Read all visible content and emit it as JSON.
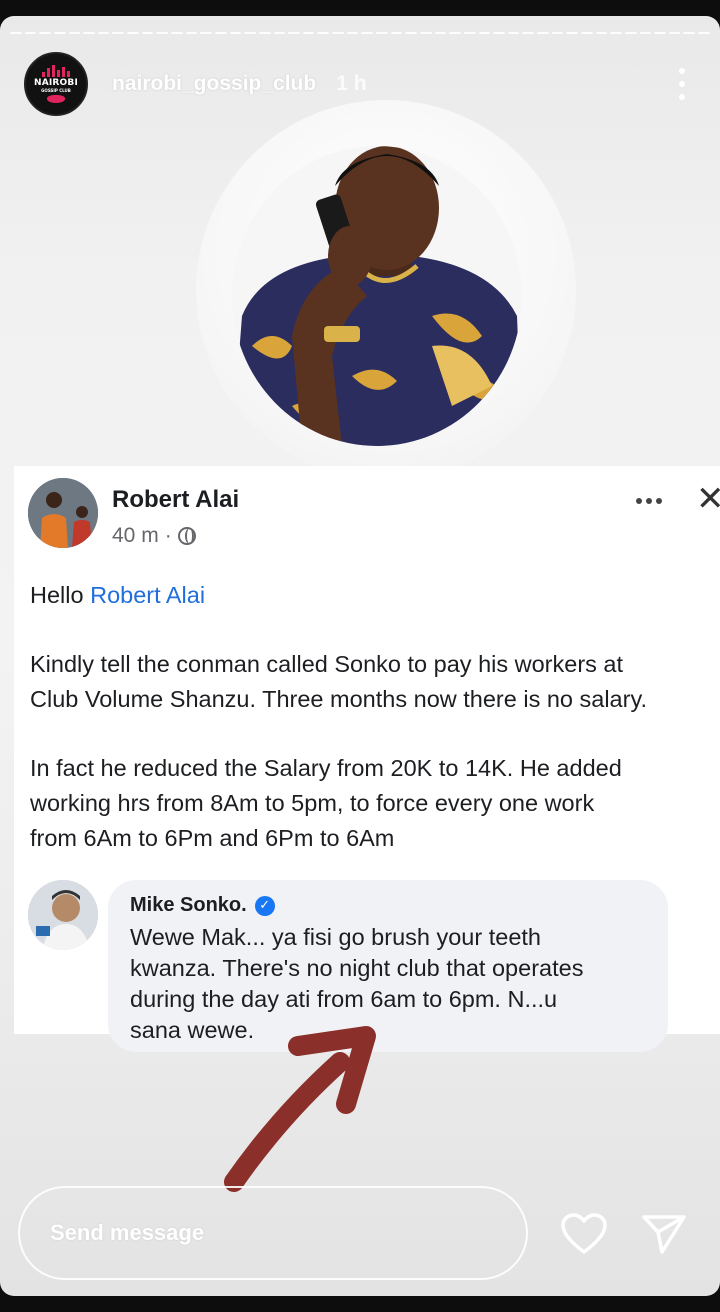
{
  "story": {
    "username": "nairobi_gossip_club",
    "time_ago": "1 h",
    "brand_line1": "NAIROBI",
    "brand_line2": "GOSSIP CLUB",
    "more_icon": "more-vertical-icon"
  },
  "post": {
    "author": "Robert Alai",
    "time": "40 m",
    "separator": "·",
    "privacy_icon": "globe-icon",
    "greeting_prefix": "Hello ",
    "greeting_mention": "Robert Alai",
    "line1": "Kindly tell the conman called Sonko to pay his workers at",
    "line2": "Club Volume Shanzu. Three months now there is no salary.",
    "line3": "In fact he reduced the Salary from 20K to 14K. He added",
    "line4": "working hrs from 8Am to 5pm, to force every one work",
    "line5": "from 6Am to 6Pm and 6Pm to 6Am"
  },
  "comment": {
    "author": "Mike Sonko.",
    "verified_icon": "verified-badge-icon",
    "text_line1": "Wewe Mak... ya fisi go brush your teeth",
    "text_line2": "kwanza. There's no night club that operates",
    "text_line3": "during the day ati from 6am to 6pm. N...u",
    "text_line4": "sana wewe."
  },
  "footer": {
    "message_placeholder": "Send message"
  },
  "colors": {
    "mention": "#216fdb",
    "arrow": "#8b2f2a",
    "verified": "#1877f2"
  }
}
